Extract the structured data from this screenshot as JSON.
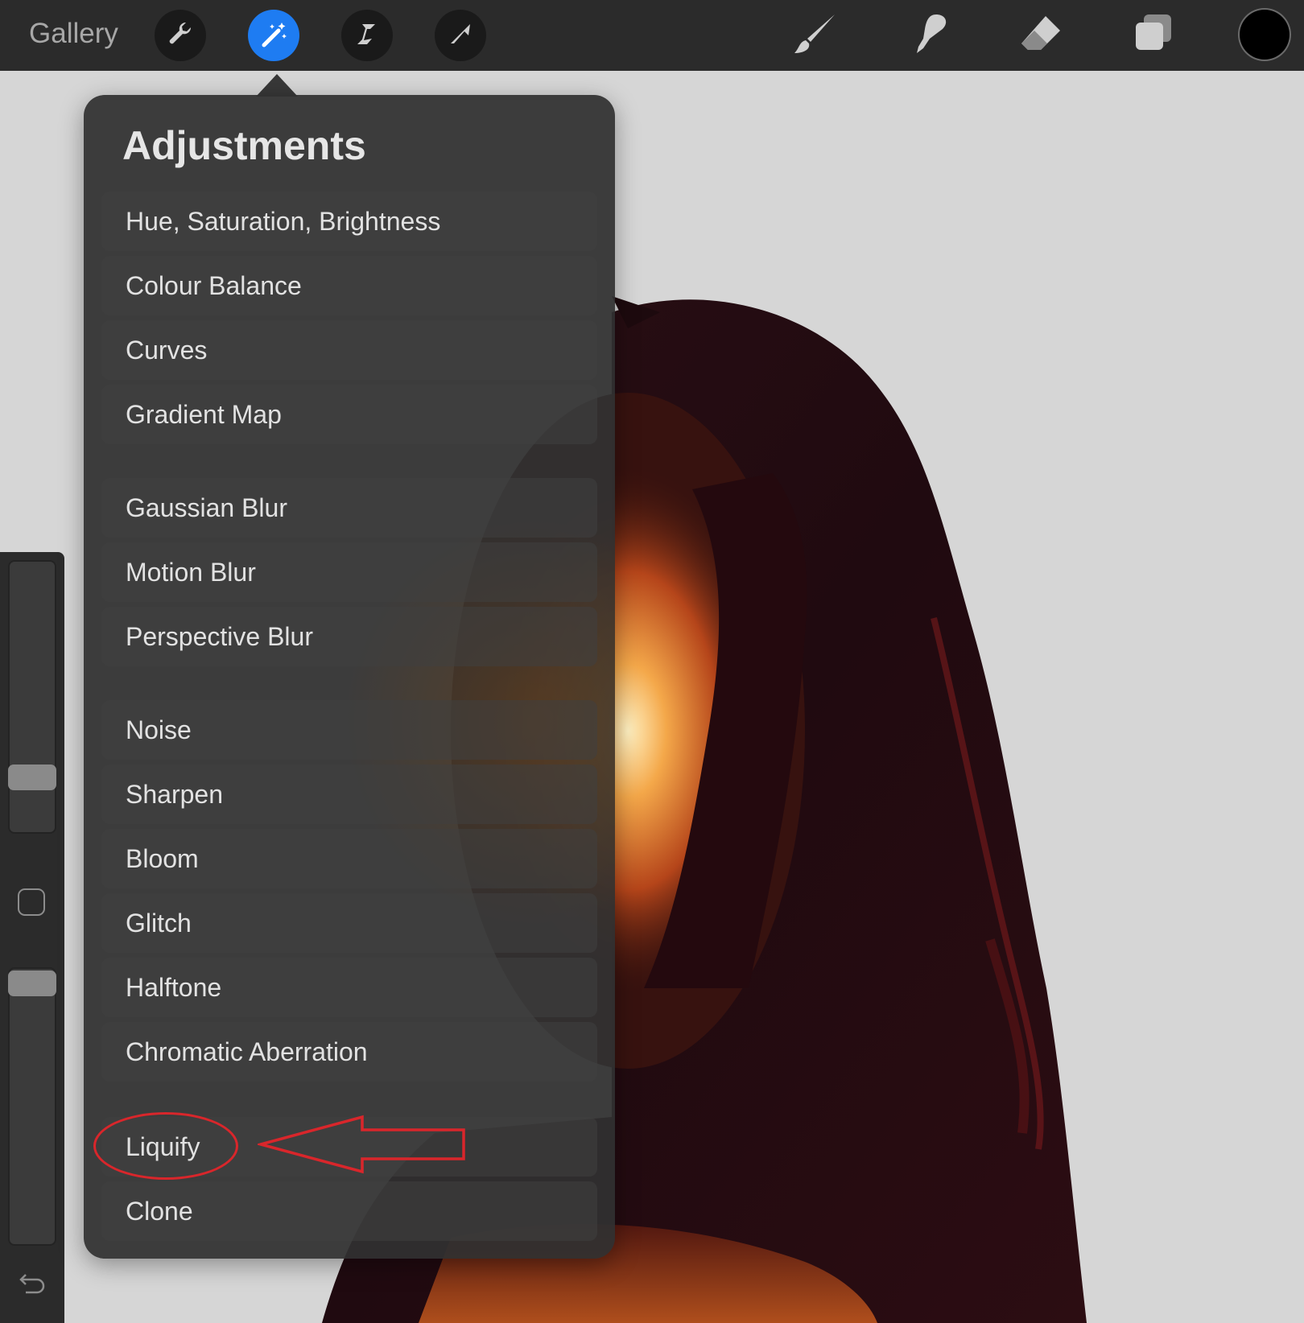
{
  "toolbar": {
    "gallery_label": "Gallery",
    "tools_left": [
      "wrench-icon",
      "magic-wand-icon",
      "selection-icon",
      "transform-icon"
    ],
    "tools_right": [
      "brush-icon",
      "smudge-icon",
      "eraser-icon",
      "layers-icon"
    ],
    "active_tool": "magic-wand-icon",
    "active_color": "#000000",
    "accent_color": "#1e7cf2"
  },
  "adjustments": {
    "title": "Adjustments",
    "groups": [
      [
        "Hue, Saturation, Brightness",
        "Colour Balance",
        "Curves",
        "Gradient Map"
      ],
      [
        "Gaussian Blur",
        "Motion Blur",
        "Perspective Blur"
      ],
      [
        "Noise",
        "Sharpen",
        "Bloom",
        "Glitch",
        "Halftone",
        "Chromatic Aberration"
      ],
      [
        "Liquify",
        "Clone"
      ]
    ]
  },
  "annotation": {
    "highlighted_item": "Liquify",
    "color": "#d9262b"
  }
}
